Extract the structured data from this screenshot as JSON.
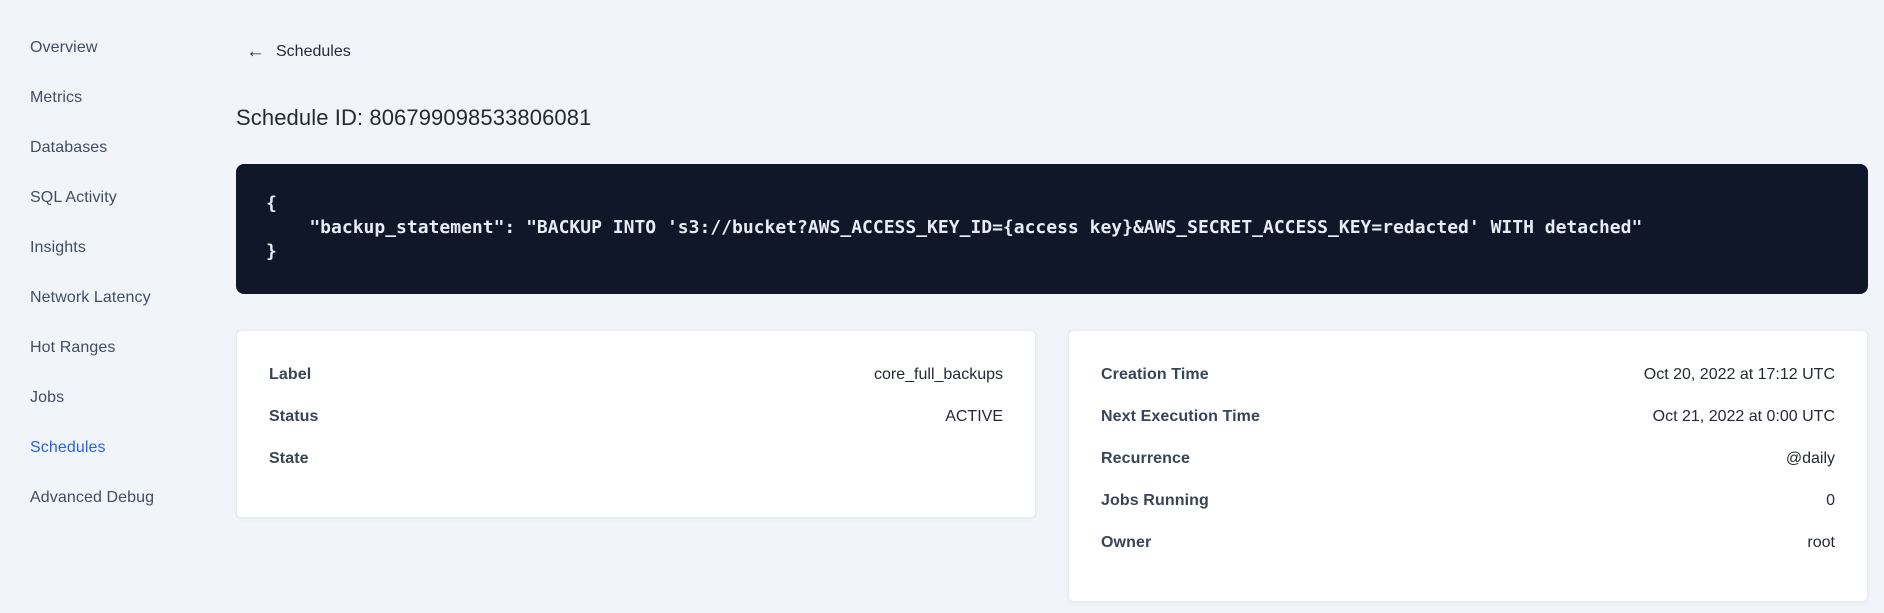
{
  "sidebar": {
    "items": [
      {
        "label": "Overview",
        "active": false
      },
      {
        "label": "Metrics",
        "active": false
      },
      {
        "label": "Databases",
        "active": false
      },
      {
        "label": "SQL Activity",
        "active": false
      },
      {
        "label": "Insights",
        "active": false
      },
      {
        "label": "Network Latency",
        "active": false
      },
      {
        "label": "Hot Ranges",
        "active": false
      },
      {
        "label": "Jobs",
        "active": false
      },
      {
        "label": "Schedules",
        "active": true
      },
      {
        "label": "Advanced Debug",
        "active": false
      }
    ]
  },
  "header": {
    "back_arrow": "←",
    "back_label": "Schedules",
    "title": "Schedule ID: 806799098533806081"
  },
  "code_block": {
    "lines": [
      "{",
      "    \"backup_statement\": \"BACKUP INTO 's3://bucket?AWS_ACCESS_KEY_ID={access key}&AWS_SECRET_ACCESS_KEY=redacted' WITH detached\"",
      "}"
    ]
  },
  "details_card": {
    "rows": [
      {
        "label": "Label",
        "value": "core_full_backups"
      },
      {
        "label": "Status",
        "value": "ACTIVE"
      },
      {
        "label": "State",
        "value": ""
      }
    ]
  },
  "schedule_card": {
    "rows": [
      {
        "label": "Creation Time",
        "value": "Oct 20, 2022 at 17:12 UTC"
      },
      {
        "label": "Next Execution Time",
        "value": "Oct 21, 2022 at 0:00 UTC"
      },
      {
        "label": "Recurrence",
        "value": "@daily"
      },
      {
        "label": "Jobs Running",
        "value": "0"
      },
      {
        "label": "Owner",
        "value": "root"
      }
    ]
  },
  "colors": {
    "page_bg": "#f1f5f9",
    "code_bg": "#0f1729",
    "accent_blue": "#2563eb",
    "text_dark": "#242a35",
    "label_dark": "#394455"
  }
}
